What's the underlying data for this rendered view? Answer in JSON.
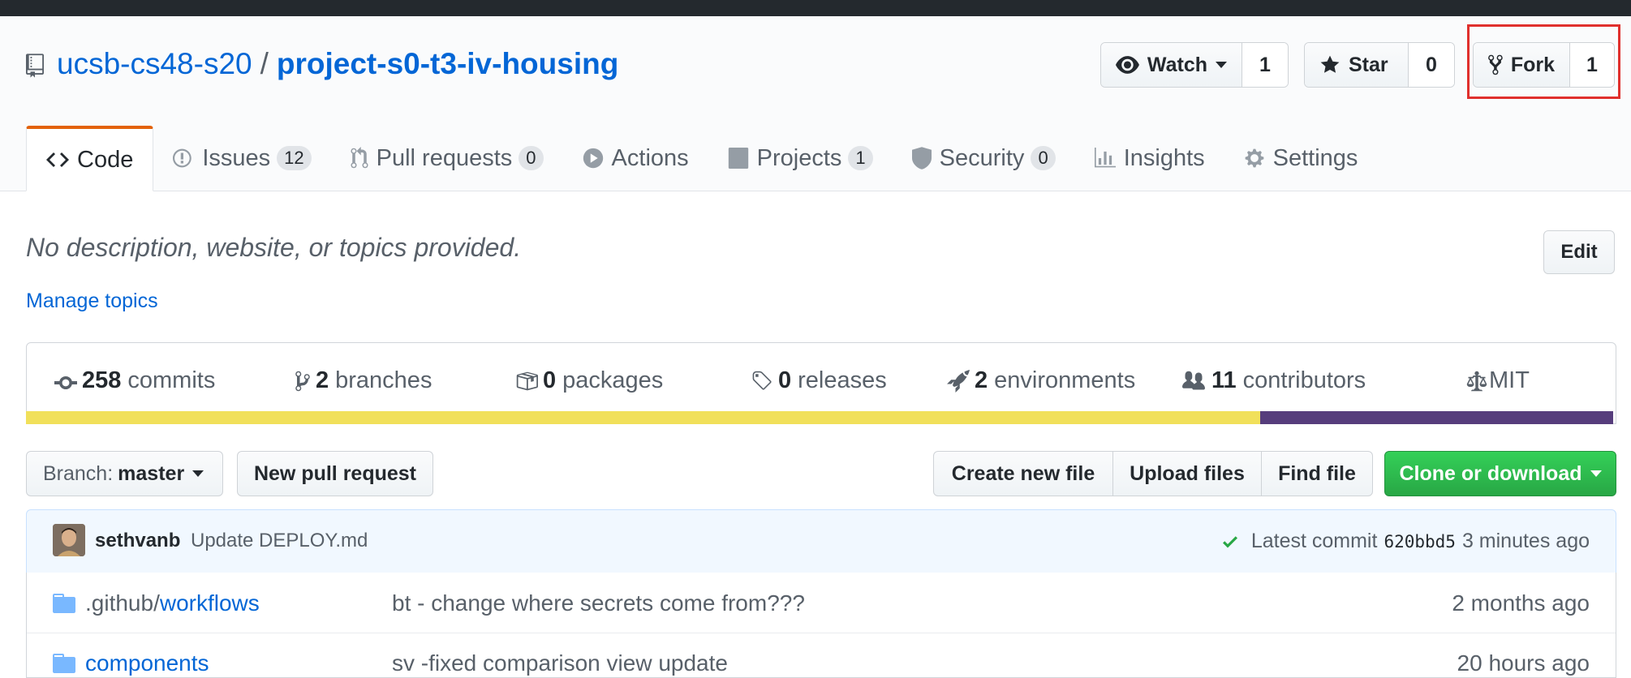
{
  "repo": {
    "owner": "ucsb-cs48-s20",
    "separator": "/",
    "name": "project-s0-t3-iv-housing"
  },
  "actions": {
    "watch": {
      "label": "Watch",
      "count": "1"
    },
    "star": {
      "label": "Star",
      "count": "0"
    },
    "fork": {
      "label": "Fork",
      "count": "1"
    }
  },
  "tabs": [
    {
      "label": "Code",
      "count": null
    },
    {
      "label": "Issues",
      "count": "12"
    },
    {
      "label": "Pull requests",
      "count": "0"
    },
    {
      "label": "Actions",
      "count": null
    },
    {
      "label": "Projects",
      "count": "1"
    },
    {
      "label": "Security",
      "count": "0"
    },
    {
      "label": "Insights",
      "count": null
    },
    {
      "label": "Settings",
      "count": null
    }
  ],
  "about": {
    "description": "No description, website, or topics provided.",
    "edit_label": "Edit",
    "manage_topics": "Manage topics"
  },
  "summary": {
    "commits": {
      "num": "258",
      "label": "commits"
    },
    "branches": {
      "num": "2",
      "label": "branches"
    },
    "packages": {
      "num": "0",
      "label": "packages"
    },
    "releases": {
      "num": "0",
      "label": "releases"
    },
    "environments": {
      "num": "2",
      "label": "environments"
    },
    "contributors": {
      "num": "11",
      "label": "contributors"
    },
    "license": "MIT"
  },
  "languages": {
    "colors": [
      "#f1e05a",
      "#563d7c"
    ]
  },
  "file_nav": {
    "branch_label": "Branch:",
    "branch_value": "master",
    "new_pr": "New pull request",
    "create_file": "Create new file",
    "upload_files": "Upload files",
    "find_file": "Find file",
    "clone": "Clone or download"
  },
  "latest_commit": {
    "author": "sethvanb",
    "message": "Update DEPLOY.md",
    "prefix": "Latest commit",
    "sha": "620bbd5",
    "age": "3 minutes ago"
  },
  "files": [
    {
      "prefix": ".github/",
      "name": "workflows",
      "message": "bt - change where secrets come from???",
      "age": "2 months ago"
    },
    {
      "prefix": "",
      "name": "components",
      "message": "sv -fixed comparison view update",
      "age": "20 hours ago"
    }
  ]
}
